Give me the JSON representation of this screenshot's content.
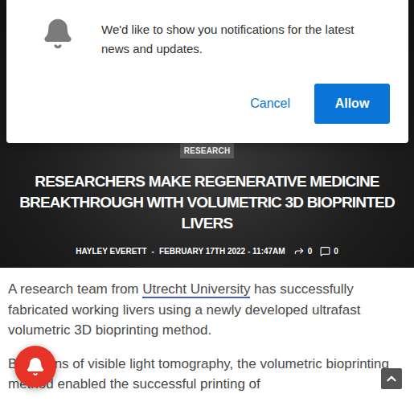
{
  "prompt": {
    "message": "We'd like to show you notifications for the latest news and updates.",
    "buttons": [
      {
        "label": "Cancel",
        "primary": false
      },
      {
        "label": "Allow",
        "primary": true
      }
    ]
  },
  "article": {
    "category": "RESEARCH",
    "title": "RESEARCHERS MAKE REGENERATIVE MEDICINE BREAKTHROUGH WITH VOLUMETRIC 3D BIOPRINTED LIVERS",
    "author": "HAYLEY EVERETT",
    "separator": "-",
    "date": "FEBRUARY 17TH 2022 - 11:47AM",
    "shares": "0",
    "comments": "0"
  },
  "body": {
    "paragraphs": [
      [
        {
          "text": "A research team from ",
          "link": false
        },
        {
          "text": "Utrecht University",
          "link": true
        },
        {
          "text": " has successfully fabricated working livers using a newly developed ultrafast volumetric 3D bioprinting method.",
          "link": false
        }
      ],
      [
        {
          "text": "By means of visible light tomography, the volumetric bioprinting method enabled the successful printing of",
          "link": false
        }
      ]
    ]
  }
}
